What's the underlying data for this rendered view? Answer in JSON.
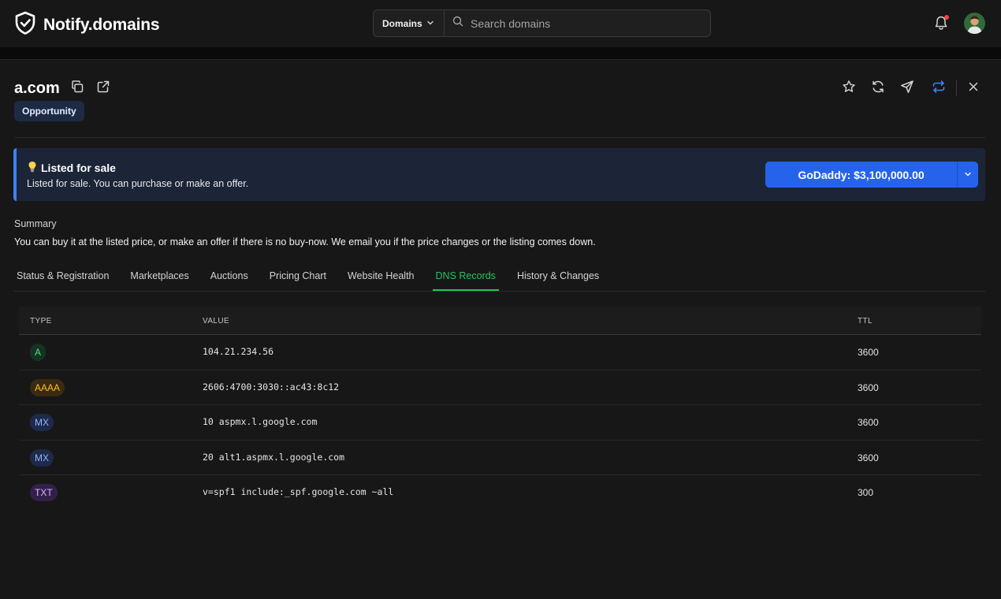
{
  "app": {
    "name": "Notify.domains"
  },
  "search": {
    "scope_label": "Domains",
    "placeholder": "Search domains"
  },
  "domain": {
    "name": "a.com",
    "tag": "Opportunity"
  },
  "alert": {
    "icon": "lightbulb-icon",
    "title": "Listed for sale",
    "body": "Listed for sale. You can purchase or make an offer.",
    "cta_label": "GoDaddy: $3,100,000.00"
  },
  "summary": {
    "label": "Summary",
    "text": "You can buy it at the listed price, or make an offer if there is no buy-now. We email you if the price changes or the listing comes down."
  },
  "tabs": [
    {
      "label": "Status & Registration",
      "active": false
    },
    {
      "label": "Marketplaces",
      "active": false
    },
    {
      "label": "Auctions",
      "active": false
    },
    {
      "label": "Pricing Chart",
      "active": false
    },
    {
      "label": "Website Health",
      "active": false
    },
    {
      "label": "DNS Records",
      "active": true
    },
    {
      "label": "History & Changes",
      "active": false
    }
  ],
  "dns": {
    "headers": {
      "type": "TYPE",
      "value": "VALUE",
      "ttl": "TTL"
    },
    "records": [
      {
        "type": "A",
        "value": "104.21.234.56",
        "ttl": "3600"
      },
      {
        "type": "AAAA",
        "value": "2606:4700:3030::ac43:8c12",
        "ttl": "3600"
      },
      {
        "type": "MX",
        "value": "10 aspmx.l.google.com",
        "ttl": "3600"
      },
      {
        "type": "MX",
        "value": "20 alt1.aspmx.l.google.com",
        "ttl": "3600"
      },
      {
        "type": "TXT",
        "value": "v=spf1 include:_spf.google.com ~all",
        "ttl": "300"
      }
    ]
  },
  "colors": {
    "accent": "#22c55e",
    "primary_button": "#2563eb",
    "alert_border": "#3b82f6",
    "badge_a": {
      "bg": "#163322",
      "fg": "#4ade80"
    },
    "badge_aaaa": {
      "bg": "#3a2a12",
      "fg": "#fbbf24"
    },
    "badge_mx": {
      "bg": "#1e2a4a",
      "fg": "#93b4ff"
    },
    "badge_txt": {
      "bg": "#33204a",
      "fg": "#d8b4fe"
    }
  }
}
